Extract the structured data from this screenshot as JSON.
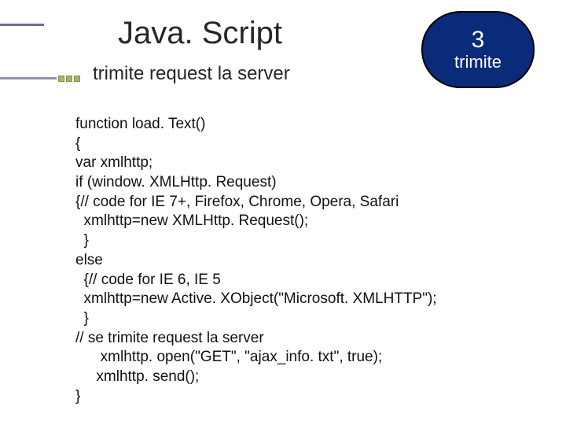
{
  "title": "Java. Script",
  "subtitle": "trimite request la server",
  "callout": {
    "num": "3",
    "text": "trimite"
  },
  "code": "function load. Text()\n{\nvar xmlhttp;\nif (window. XMLHttp. Request)\n{// code for IE 7+, Firefox, Chrome, Opera, Safari\n  xmlhttp=new XMLHttp. Request();\n  }\nelse\n  {// code for IE 6, IE 5\n  xmlhttp=new Active. XObject(\"Microsoft. XMLHTTP\");\n  }\n// se trimite request la server\n      xmlhttp. open(\"GET\", \"ajax_info. txt\", true);\n     xmlhttp. send();\n}"
}
